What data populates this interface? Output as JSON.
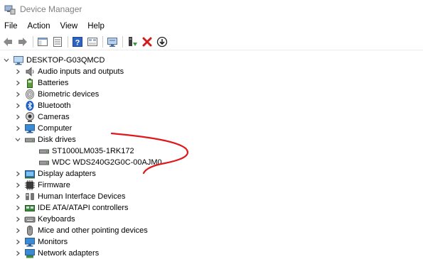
{
  "window": {
    "title": "Device Manager"
  },
  "menu": [
    "File",
    "Action",
    "View",
    "Help"
  ],
  "colors": {
    "title_text": "#808080",
    "annotation": "#e0181b",
    "delete_icon": "#d31b1b",
    "help_icon": "#2e63c4"
  },
  "toolbar": {
    "buttons": [
      {
        "icon": "back-arrow-icon"
      },
      {
        "icon": "forward-arrow-icon"
      },
      {
        "icon": "console-tree-icon"
      },
      {
        "icon": "properties-icon"
      },
      {
        "icon": "help-icon"
      },
      {
        "icon": "device-view-icon"
      },
      {
        "icon": "scan-monitor-icon"
      },
      {
        "icon": "update-driver-icon"
      },
      {
        "icon": "uninstall-x-icon"
      },
      {
        "icon": "download-circle-icon"
      }
    ]
  },
  "tree": {
    "root": "DESKTOP-G03QMCD",
    "categories": [
      {
        "label": "Audio inputs and outputs",
        "icon": "speaker-icon",
        "expanded": false
      },
      {
        "label": "Batteries",
        "icon": "battery-icon",
        "expanded": false
      },
      {
        "label": "Biometric devices",
        "icon": "fingerprint-icon",
        "expanded": false
      },
      {
        "label": "Bluetooth",
        "icon": "bluetooth-icon",
        "expanded": false
      },
      {
        "label": "Cameras",
        "icon": "camera-icon",
        "expanded": false
      },
      {
        "label": "Computer",
        "icon": "computer-icon",
        "expanded": false
      },
      {
        "label": "Disk drives",
        "icon": "disk-drive-icon",
        "expanded": true,
        "children": [
          "ST1000LM035-1RK172",
          "WDC WDS240G2G0C-00AJM0"
        ]
      },
      {
        "label": "Display adapters",
        "icon": "display-adapter-icon",
        "expanded": false
      },
      {
        "label": "Firmware",
        "icon": "firmware-icon",
        "expanded": false
      },
      {
        "label": "Human Interface Devices",
        "icon": "hid-icon",
        "expanded": false
      },
      {
        "label": "IDE ATA/ATAPI controllers",
        "icon": "ide-controller-icon",
        "expanded": false
      },
      {
        "label": "Keyboards",
        "icon": "keyboard-icon",
        "expanded": false
      },
      {
        "label": "Mice and other pointing devices",
        "icon": "mouse-icon",
        "expanded": false
      },
      {
        "label": "Monitors",
        "icon": "monitor-icon",
        "expanded": false
      },
      {
        "label": "Network adapters",
        "icon": "network-adapter-icon",
        "expanded": false
      }
    ]
  }
}
